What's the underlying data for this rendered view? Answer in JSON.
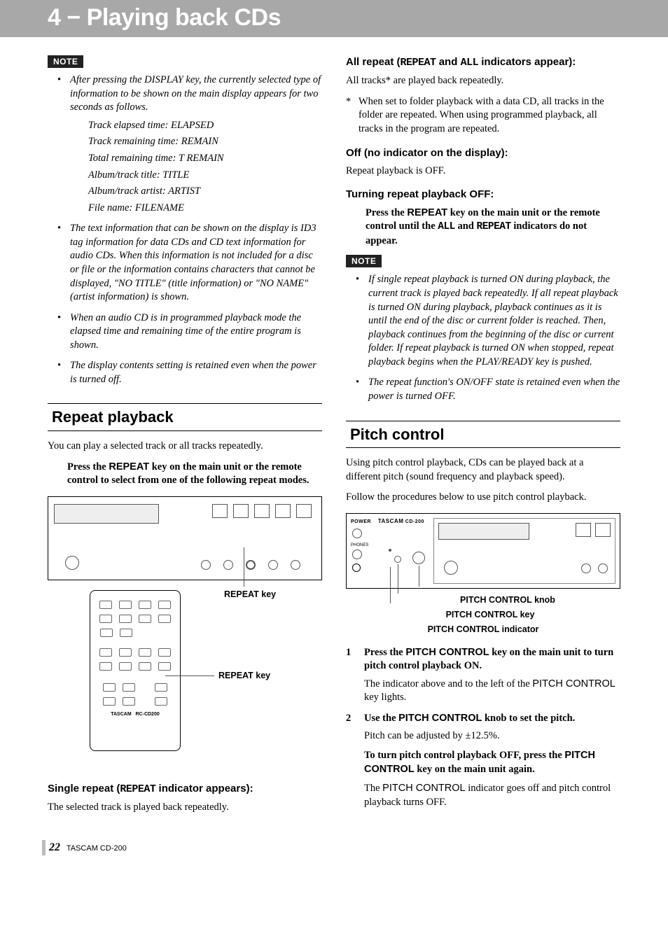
{
  "banner": "4 − Playing back CDs",
  "left": {
    "note_label": "NOTE",
    "b1": "After pressing the DISPLAY key, the currently selected type of information to be shown on the main display appears for two seconds as follows.",
    "sub": [
      "Track elapsed time: ELAPSED",
      "Track remaining time: REMAIN",
      "Total remaining time: T REMAIN",
      "Album/track title: TITLE",
      "Album/track artist: ARTIST",
      "File name: FILENAME"
    ],
    "b2": "The text information that can be shown on the display is ID3 tag information for data CDs and CD text information for audio CDs. When this information is not included for a disc or file or the information contains characters that cannot be displayed, \"NO TITLE\" (title information) or \"NO NAME\" (artist information) is shown.",
    "b3": "When an audio CD is in programmed playback mode the elapsed time and remaining time of the entire program is shown.",
    "b4": "The display contents setting is retained even when the power is turned off.",
    "h_repeat": "Repeat playback",
    "rp_intro": "You can play a selected track or all tracks repeatedly.",
    "rp_press_a": "Press the ",
    "rp_press_key": "REPEAT",
    "rp_press_b": " key on the main unit or the remote control to select from one of the following repeat modes.",
    "fig1_callout": "REPEAT key",
    "fig2_callout": "REPEAT key",
    "single_h_a": "Single repeat (",
    "single_h_mono": "REPEAT",
    "single_h_b": " indicator appears):",
    "single_p": "The selected track is played back repeatedly."
  },
  "right": {
    "all_h_a": "All repeat (",
    "all_h_mono1": "REPEAT",
    "all_h_mid": " and ",
    "all_h_mono2": "ALL",
    "all_h_b": " indicators appear):",
    "all_p": "All tracks* are played back repeatedly.",
    "star": "When set to folder playback with a data CD, all tracks in the folder are repeated. When using programmed playback, all tracks in the program are repeated.",
    "off_h": "Off (no indicator on the display):",
    "off_p": "Repeat playback is OFF.",
    "turn_h": "Turning repeat playback OFF:",
    "turn_a": "Press the ",
    "turn_key": "REPEAT",
    "turn_b": " key on the main unit or the remote control until the ",
    "turn_mono1": "ALL",
    "turn_mid": " and ",
    "turn_mono2": "REPEAT",
    "turn_c": " indicators do not appear.",
    "note_label": "NOTE",
    "nb1": "If single repeat playback is turned ON during playback, the current track is played back repeatedly. If all repeat playback is turned ON during playback, playback continues as it is until the end of the disc or current folder is reached. Then, playback continues from the beginning of the disc or current folder. If repeat playback is turned ON when stopped, repeat playback begins when the PLAY/READY key is pushed.",
    "nb2": "The repeat function's ON/OFF state is retained even when the power is turned OFF.",
    "h_pitch": "Pitch control",
    "pc_intro": "Using pitch control playback, CDs can be played back at a different pitch (sound frequency and playback speed).",
    "pc_follow": "Follow the procedures below to use pitch control playback.",
    "fig_knob": "PITCH CONTROL knob",
    "fig_key": "PITCH CONTROL key",
    "fig_ind": "PITCH CONTROL indicator",
    "s1_a": "Press the ",
    "s1_key": "PITCH CONTROL",
    "s1_b": " key on the main unit to turn pitch control playback ON.",
    "s1_p_a": "The indicator above and to the left of the ",
    "s1_p_key": "PITCH CONTROL",
    "s1_p_b": " key lights.",
    "s2_a": "Use the ",
    "s2_key": "PITCH CONTROL",
    "s2_b": " knob to set the pitch.",
    "s2_p": "Pitch can be adjusted by ±12.5%.",
    "off2_a": "To turn pitch control playback OFF, press the ",
    "off2_key": "PITCH CONTROL",
    "off2_b": " key on the main unit again.",
    "off2_p_a": "The ",
    "off2_p_key": "PITCH CONTROL",
    "off2_p_b": " indicator goes off and pitch control playback turns OFF."
  },
  "footer": {
    "pn": "22",
    "model": "TASCAM  CD-200"
  }
}
